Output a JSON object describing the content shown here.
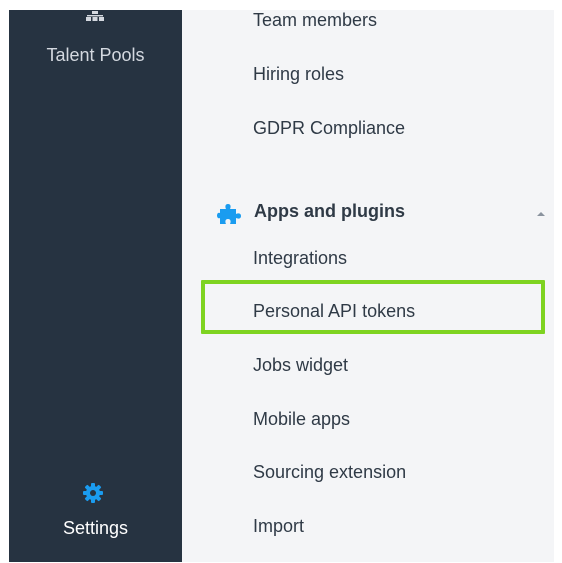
{
  "sidebar": {
    "talent_pools_label": "Talent Pools",
    "settings_label": "Settings",
    "icons": {
      "talent_pools": "org-chart-icon",
      "settings": "gear-icon"
    },
    "colors": {
      "background": "#263341",
      "settings_icon": "#1a9cf0"
    }
  },
  "settings_menu": {
    "items_top": [
      "Team members",
      "Hiring roles",
      "GDPR Compliance"
    ],
    "section": {
      "title": "Apps and plugins",
      "icon": "puzzle-piece-icon",
      "caret": "caret-up-icon",
      "icon_color": "#1a9cf0"
    },
    "section_items": [
      "Integrations",
      "Personal API tokens",
      "Jobs widget",
      "Mobile apps",
      "Sourcing extension",
      "Import"
    ],
    "highlighted_item": "Personal API tokens",
    "highlight_color": "#7ed321"
  }
}
